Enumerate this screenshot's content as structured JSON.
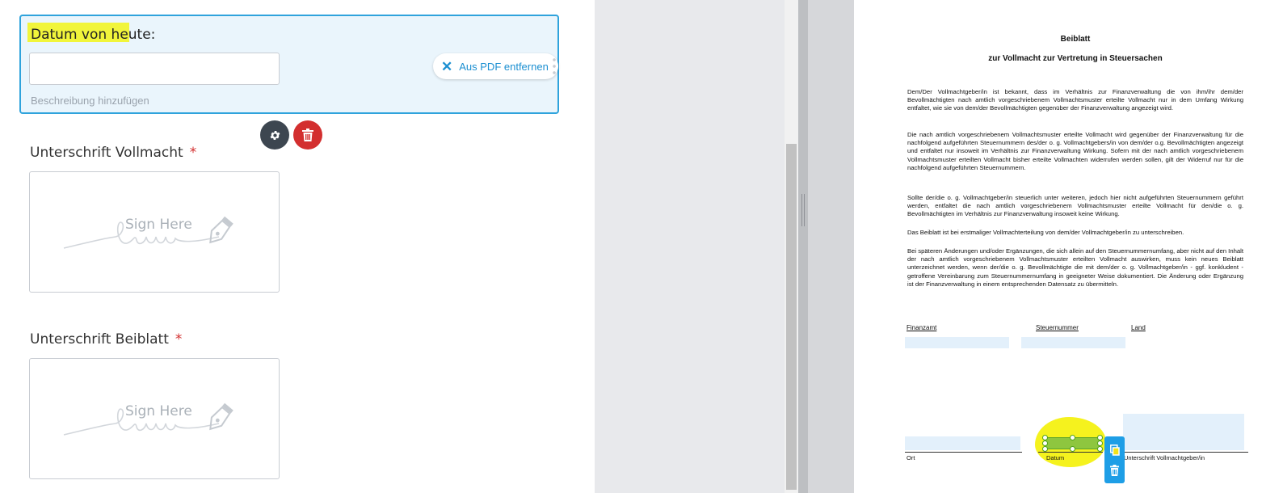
{
  "form": {
    "date_field": {
      "label": "Datum von heute:",
      "value": "",
      "placeholder": "",
      "description_hint": "Beschreibung hinzufügen",
      "remove_label": "Aus PDF entfernen"
    },
    "signatures": [
      {
        "label": "Unterschrift Vollmacht",
        "required_mark": "*",
        "placeholder": "Sign Here"
      },
      {
        "label": "Unterschrift Beiblatt",
        "required_mark": "*",
        "placeholder": "Sign Here"
      }
    ]
  },
  "pdf": {
    "title": "Beiblatt",
    "subtitle": "zur Vollmacht zur Vertretung in Steuersachen",
    "paragraphs": [
      "Dem/Der Vollmachtgeber/in ist bekannt, dass im Verhältnis zur Finanzverwaltung die von ihm/ihr dem/der Bevollmächtigten nach amtlich vorgeschriebenem Vollmachtsmuster erteilte Vollmacht nur in dem Umfang Wirkung entfaltet, wie sie von dem/der Bevollmächtigten gegenüber der Finanzverwaltung angezeigt wird.",
      "Die nach amtlich vorgeschriebenem Vollmachtsmuster erteilte Vollmacht wird gegenüber der Finanzverwaltung für die nachfolgend aufgeführten Steuernummern des/der o. g. Vollmachtgebers/in von dem/der o.g. Bevollmächtigten angezeigt und entfaltet nur insoweit im Verhältnis zur Finanzverwaltung Wirkung. Sofern mit der nach amtlich vorgeschriebenem Vollmachtsmuster erteilten Vollmacht bisher erteilte Vollmachten widerrufen werden sollen, gilt der Widerruf nur für die nachfolgend aufgeführten Steuernummern.",
      "Sollte der/die o. g. Vollmachtgeber/in steuerlich unter weiteren, jedoch hier nicht aufgeführten Steuernummern geführt werden, entfaltet die nach amtlich vorgeschriebenem Vollmachtsmuster erteilte Vollmacht für den/die o. g. Bevollmächtigten im Verhältnis zur Finanzverwaltung insoweit keine Wirkung.",
      "Das Beiblatt ist bei erstmaliger Vollmachterteilung von dem/der Vollmachtgeber/in zu unterschreiben.",
      "Bei späteren Änderungen und/oder Ergänzungen, die sich allein auf den Steuernummernumfang, aber nicht auf den Inhalt der nach amtlich vorgeschriebenem Vollmachtsmuster erteilten Vollmacht auswirken, muss kein neues Beiblatt unterzeichnet werden, wenn der/die o. g. Bevollmächtigte die mit dem/der o. g. Vollmachtgeber/in - ggf. konkludent - getroffene Vereinbarung zum Steuernummernumfang in geeigneter Weise dokumentiert. Die Änderung oder Ergänzung ist der Finanzverwaltung in einem entsprechenden Datensatz zu übermitteln."
    ],
    "columns": {
      "finanzamt": "Finanzamt",
      "steuernummer": "Steuernummer",
      "land": "Land"
    },
    "footer": {
      "ort": "Ort",
      "datum": "Datum",
      "unterschrift": "Unterschrift Vollmachtgeber/in"
    }
  },
  "colors": {
    "accent": "#2fa3dc",
    "field_bg": "#eaf5fc",
    "danger": "#d32f2f",
    "highlight": "#f1f53b",
    "pdf_field": "#e3f0fb",
    "selected_field": "#8ec63f"
  }
}
